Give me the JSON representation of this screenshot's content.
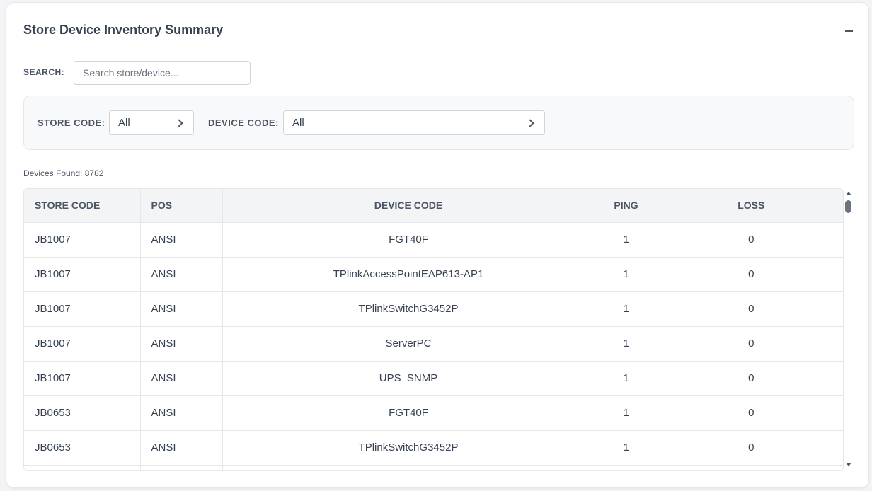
{
  "panel": {
    "title": "Store Device Inventory Summary",
    "collapse_label": "−"
  },
  "search": {
    "label": "SEARCH:",
    "placeholder": "Search store/device...",
    "value": ""
  },
  "filters": {
    "store_code": {
      "label": "STORE CODE:",
      "value": "All"
    },
    "device_code": {
      "label": "DEVICE CODE:",
      "value": "All"
    }
  },
  "results": {
    "label": "Devices Found:",
    "count": "8782"
  },
  "table": {
    "columns": [
      "STORE CODE",
      "POS",
      "DEVICE CODE",
      "PING",
      "LOSS"
    ],
    "rows": [
      [
        "JB1007",
        "ANSI",
        "FGT40F",
        "1",
        "0"
      ],
      [
        "JB1007",
        "ANSI",
        "TPlinkAccessPointEAP613-AP1",
        "1",
        "0"
      ],
      [
        "JB1007",
        "ANSI",
        "TPlinkSwitchG3452P",
        "1",
        "0"
      ],
      [
        "JB1007",
        "ANSI",
        "ServerPC",
        "1",
        "0"
      ],
      [
        "JB1007",
        "ANSI",
        "UPS_SNMP",
        "1",
        "0"
      ],
      [
        "JB0653",
        "ANSI",
        "FGT40F",
        "1",
        "0"
      ],
      [
        "JB0653",
        "ANSI",
        "TPlinkSwitchG3452P",
        "1",
        "0"
      ],
      [
        "",
        "",
        "",
        "",
        ""
      ]
    ]
  },
  "colors": {
    "accent_text": "#374151",
    "header_bg": "#f3f4f6",
    "border": "#e5e7eb"
  }
}
